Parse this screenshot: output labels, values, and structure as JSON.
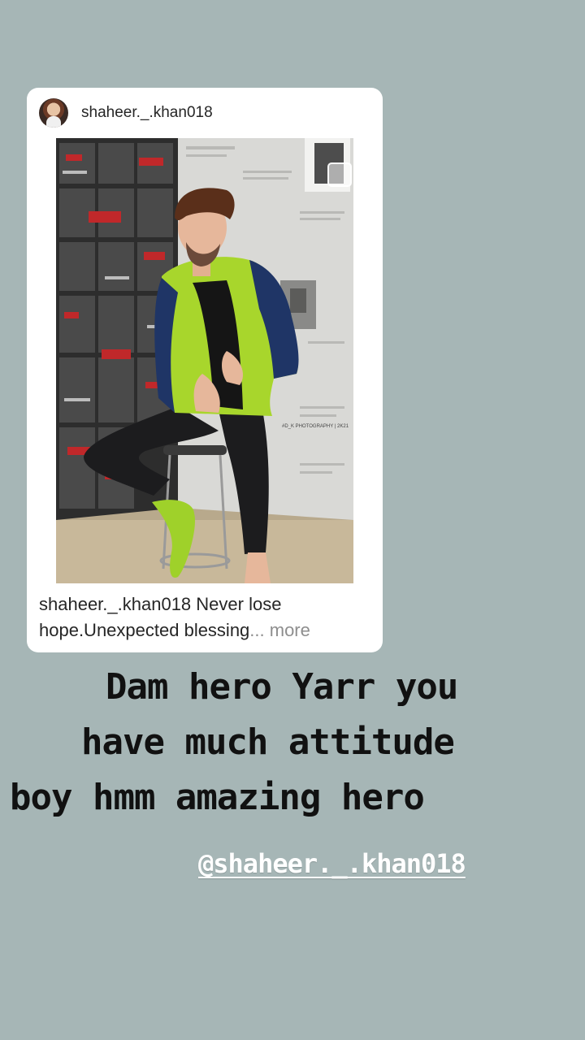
{
  "shared_post": {
    "username": "shaheer._.khan018",
    "caption_user": "shaheer._.khan018",
    "caption_text": " Never lose hope.Unexpected blessing",
    "caption_more": "... more",
    "photo_watermark": "#D_K PHOTOGRAPHY | 2K21"
  },
  "story": {
    "text_lines": [
      "Dam hero Yarr you",
      "have much attitude",
      "boy hmm amazing hero"
    ],
    "mention": "@shaheer._.khan018"
  },
  "colors": {
    "background": "#a6b6b6",
    "jacket_green": "#a8d62c",
    "jacket_navy": "#1f3566"
  }
}
